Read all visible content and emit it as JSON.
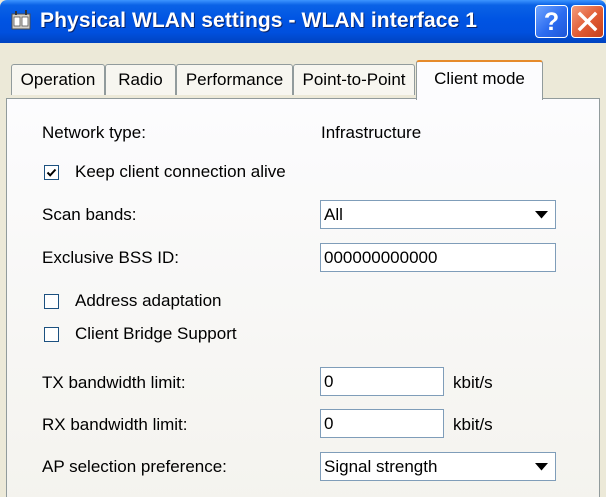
{
  "window": {
    "title": "Physical WLAN settings - WLAN interface 1",
    "help_label": "?"
  },
  "tabs": [
    {
      "label": "Operation",
      "active": false
    },
    {
      "label": "Radio",
      "active": false
    },
    {
      "label": "Performance",
      "active": false
    },
    {
      "label": "Point-to-Point",
      "active": false
    },
    {
      "label": "Client mode",
      "active": true
    }
  ],
  "form": {
    "network_type_label": "Network type:",
    "network_type_value": "Infrastructure",
    "keep_alive_label": "Keep client connection alive",
    "keep_alive_checked": true,
    "scan_bands_label": "Scan bands:",
    "scan_bands_value": "All",
    "bss_id_label": "Exclusive BSS ID:",
    "bss_id_value": "000000000000",
    "address_adaptation_label": "Address adaptation",
    "address_adaptation_checked": false,
    "client_bridge_label": "Client Bridge Support",
    "client_bridge_checked": false,
    "tx_label": "TX bandwidth limit:",
    "tx_value": "0",
    "tx_unit": "kbit/s",
    "rx_label": "RX bandwidth limit:",
    "rx_value": "0",
    "rx_unit": "kbit/s",
    "ap_pref_label": "AP selection preference:",
    "ap_pref_value": "Signal strength"
  },
  "colors": {
    "titlebar": "#0054e3",
    "active_tab_accent": "#e68b2c",
    "close_button": "#e05a33"
  },
  "icons": [
    "app-icon",
    "help-icon",
    "close-icon",
    "checkmark-icon",
    "dropdown-arrow-icon"
  ]
}
